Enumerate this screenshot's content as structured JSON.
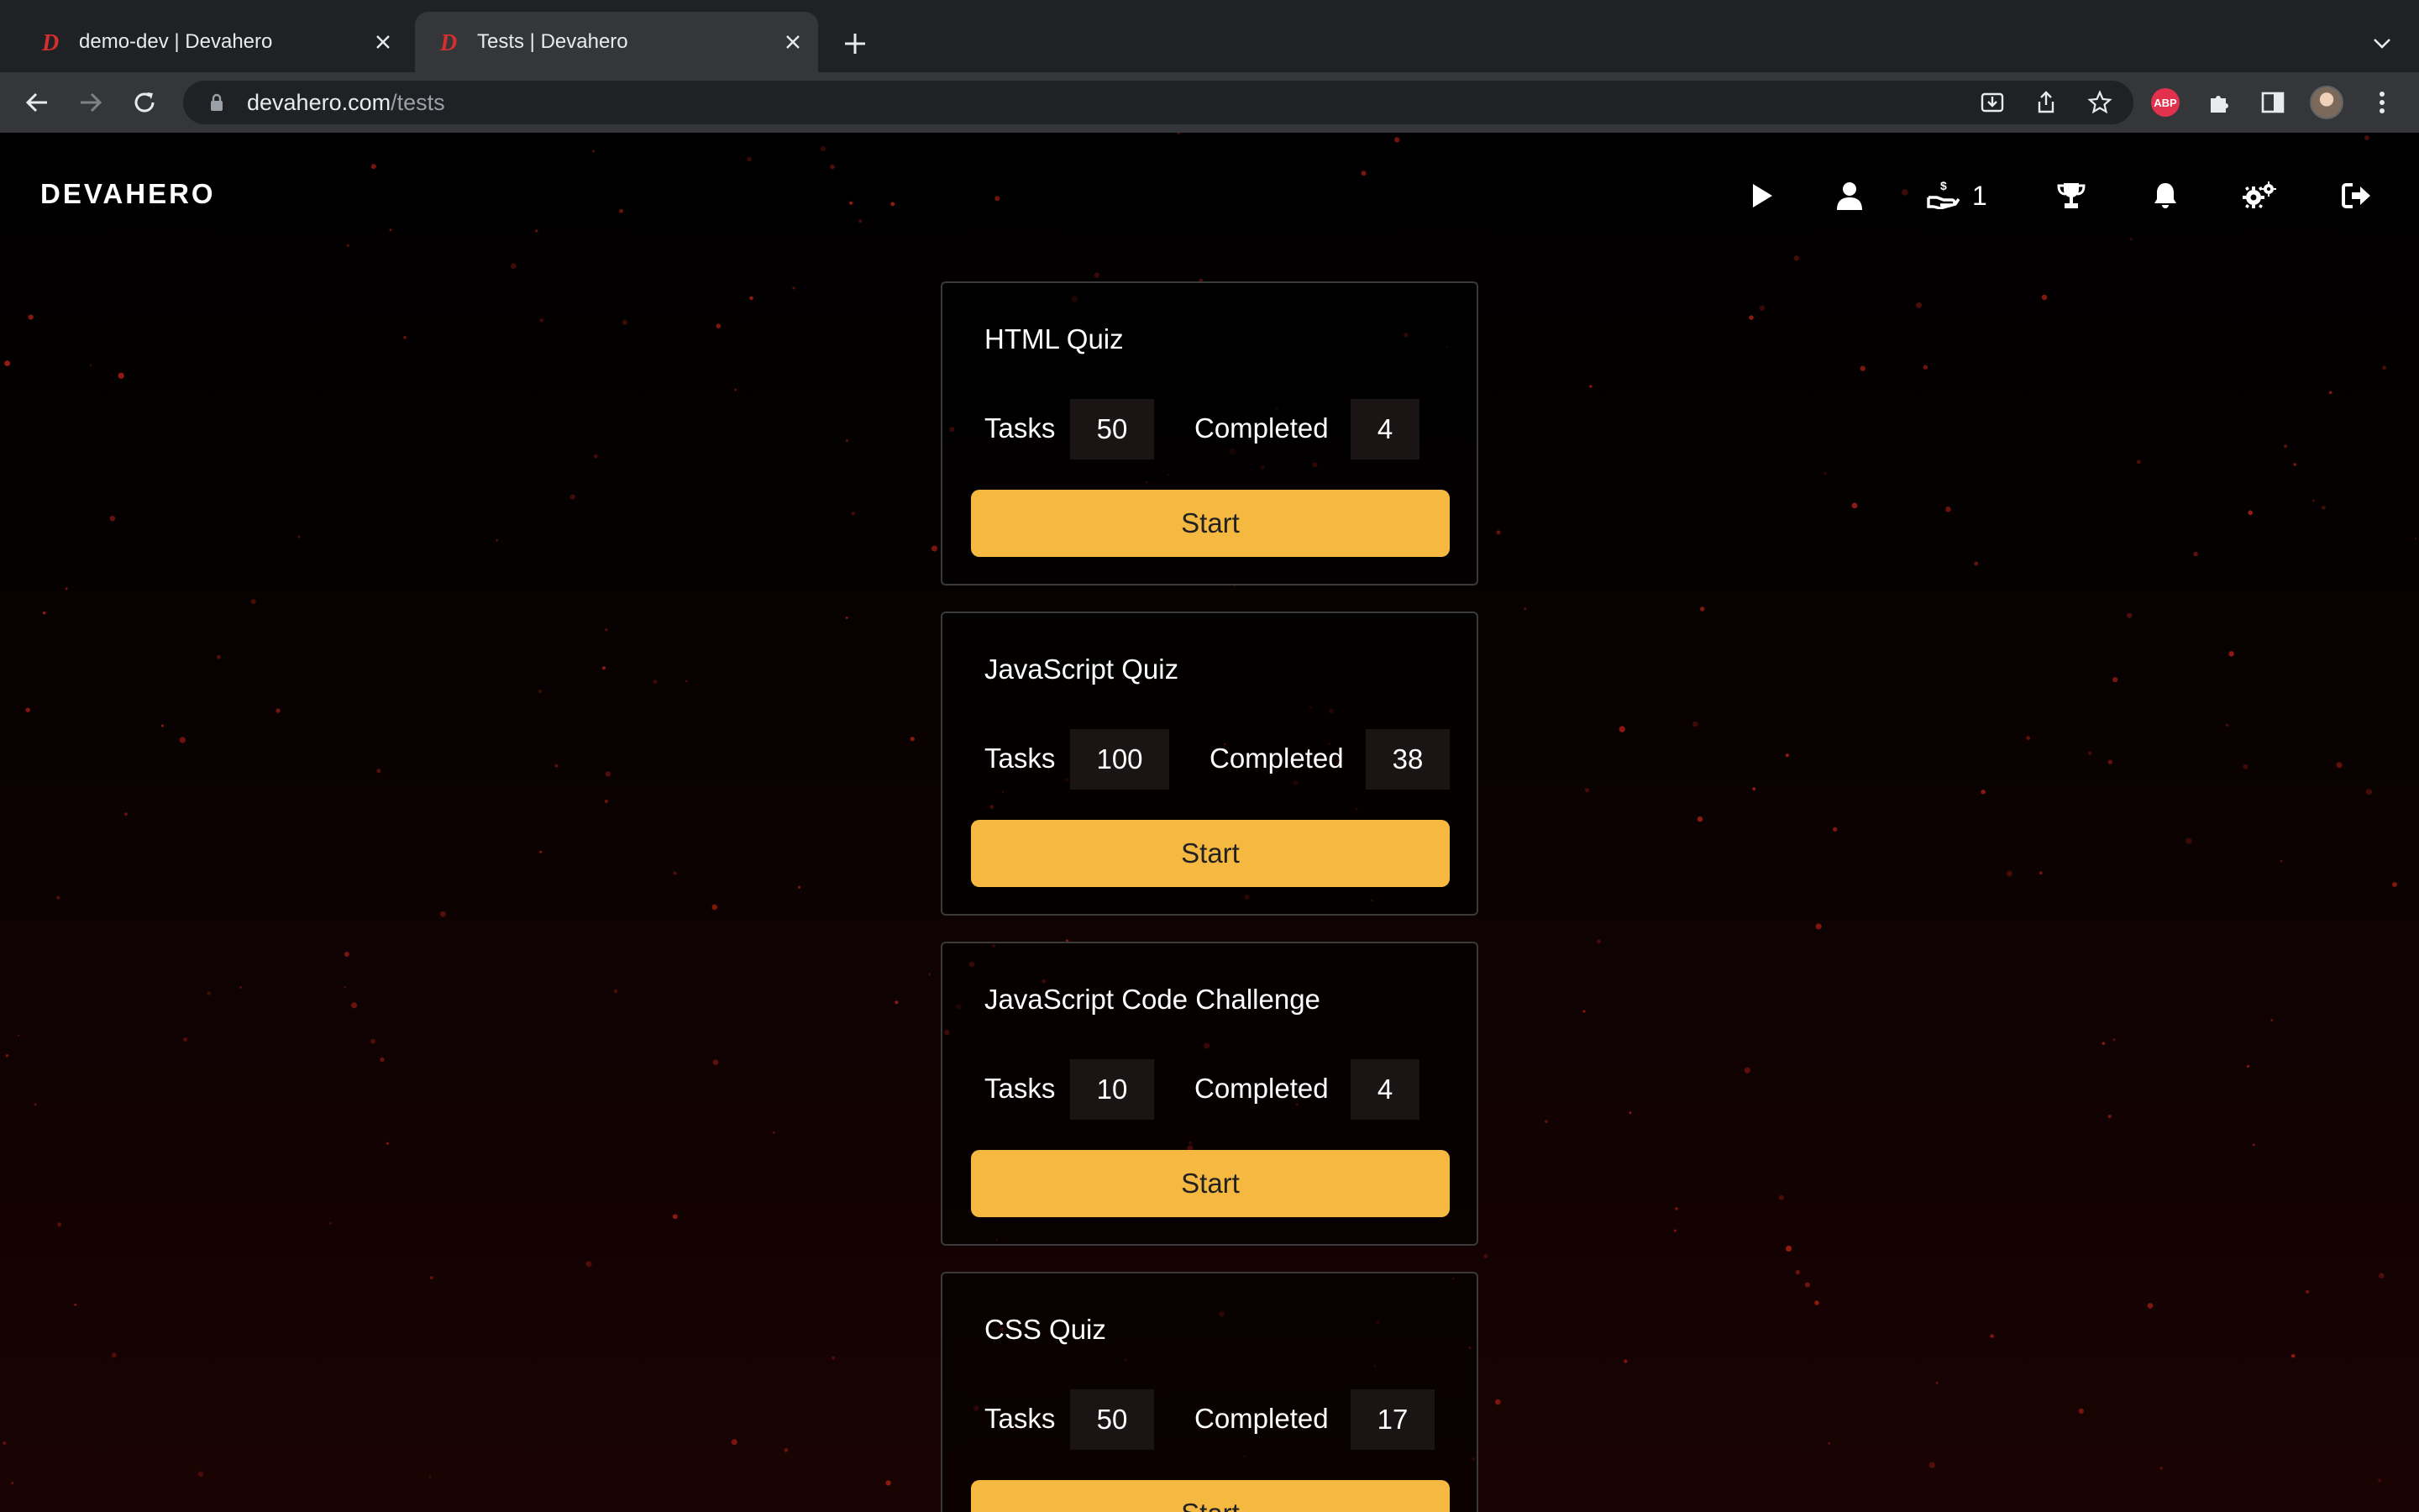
{
  "browser": {
    "tabs": [
      {
        "title": "demo-dev | Devahero",
        "active": false
      },
      {
        "title": "Tests | Devahero",
        "active": true
      }
    ],
    "address": {
      "host": "devahero.com",
      "path": "/tests"
    },
    "extension_badge": "ABP"
  },
  "header": {
    "logo": "DEVAHERO",
    "icons": [
      "play-icon",
      "user-icon",
      "hand-coin-icon",
      "trophy-icon",
      "bell-icon",
      "gears-icon",
      "sign-out-icon"
    ],
    "coins_count": "1"
  },
  "tests": [
    {
      "title": "HTML Quiz",
      "tasks_label": "Tasks",
      "tasks": "50",
      "completed_label": "Completed",
      "completed": "4",
      "button": "Start"
    },
    {
      "title": "JavaScript Quiz",
      "tasks_label": "Tasks",
      "tasks": "100",
      "completed_label": "Completed",
      "completed": "38",
      "button": "Start"
    },
    {
      "title": "JavaScript Code Challenge",
      "tasks_label": "Tasks",
      "tasks": "10",
      "completed_label": "Completed",
      "completed": "4",
      "button": "Start"
    },
    {
      "title": "CSS Quiz",
      "tasks_label": "Tasks",
      "tasks": "50",
      "completed_label": "Completed",
      "completed": "17",
      "button": "Start"
    }
  ],
  "colors": {
    "accent": "#f5b942",
    "background": "#000000",
    "particles": "#a51d14"
  }
}
